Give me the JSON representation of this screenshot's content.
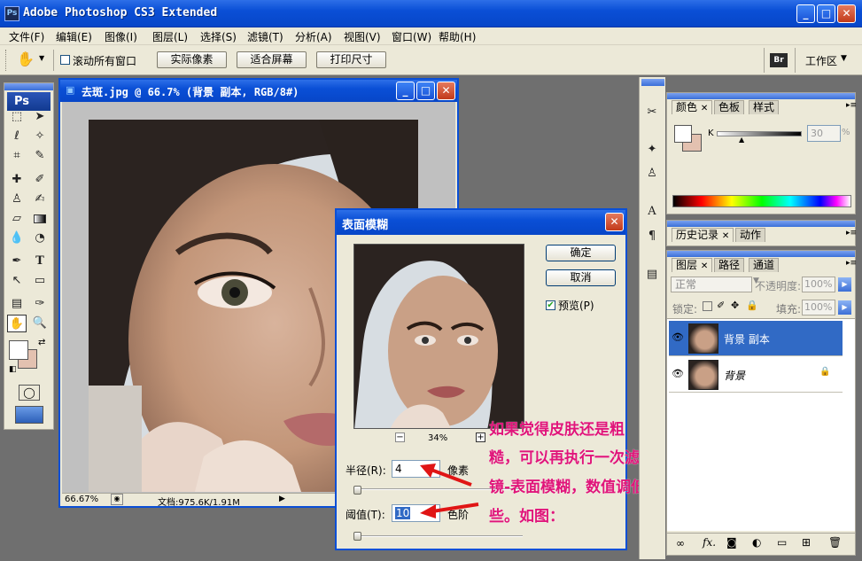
{
  "app": {
    "title": "Adobe Photoshop CS3 Extended",
    "logo": "Ps",
    "window_controls": {
      "minimize": "_",
      "maximize": "□",
      "close": "✕"
    }
  },
  "menu": [
    "文件(F)",
    "编辑(E)",
    "图像(I)",
    "图层(L)",
    "选择(S)",
    "滤镜(T)",
    "分析(A)",
    "视图(V)",
    "窗口(W)",
    "帮助(H)"
  ],
  "options_bar": {
    "scroll_all_windows": "滚动所有窗口",
    "actual_pixels": "实际像素",
    "fit_screen": "适合屏幕",
    "print_size": "打印尺寸",
    "bridge": "Br",
    "workspace": "工作区"
  },
  "document": {
    "title": "去斑.jpg @ 66.7% (背景 副本, RGB/8#)",
    "zoom": "66.67%",
    "doc_size": "文档:975.6K/1.91M"
  },
  "dialog": {
    "title": "表面模糊",
    "ok": "确定",
    "cancel": "取消",
    "preview_label": "预览(P)",
    "preview_checked": true,
    "zoom": "34%",
    "zoom_out": "−",
    "zoom_in": "+",
    "radius_label": "半径(R):",
    "radius_value": "4",
    "radius_unit": "像素",
    "threshold_label": "阈值(T):",
    "threshold_value": "10",
    "threshold_unit": "色阶"
  },
  "annotation": {
    "lines": [
      "如果觉得皮肤还是粗",
      "糙，可以再执行一次滤",
      "镜-表面模糊，数值调低",
      "些。如图："
    ]
  },
  "color_panel": {
    "tabs": [
      "颜色",
      "色板",
      "样式"
    ],
    "channel_label": "K",
    "k_value": "30",
    "unit": "%"
  },
  "history_panel": {
    "tabs": [
      "历史记录",
      "动作"
    ]
  },
  "layers_panel": {
    "tabs": [
      "图层",
      "路径",
      "通道"
    ],
    "blend_mode": "正常",
    "opacity_label": "不透明度:",
    "opacity_value": "100%",
    "lock_label": "锁定:",
    "fill_label": "填充:",
    "fill_value": "100%",
    "layers": [
      {
        "name": "背景 副本",
        "selected": true
      },
      {
        "name": "背景",
        "selected": false
      }
    ],
    "bottom_icons": [
      "link-icon",
      "fx",
      "mask-icon",
      "adjustment-icon",
      "folder-icon",
      "new-layer-icon",
      "trash-icon"
    ],
    "fx_label": "fx."
  },
  "colors": {
    "accent": "#0a4fd6",
    "foreground": "#ffffff",
    "background": "#e3c1b0",
    "annotation": "#e0157a"
  }
}
